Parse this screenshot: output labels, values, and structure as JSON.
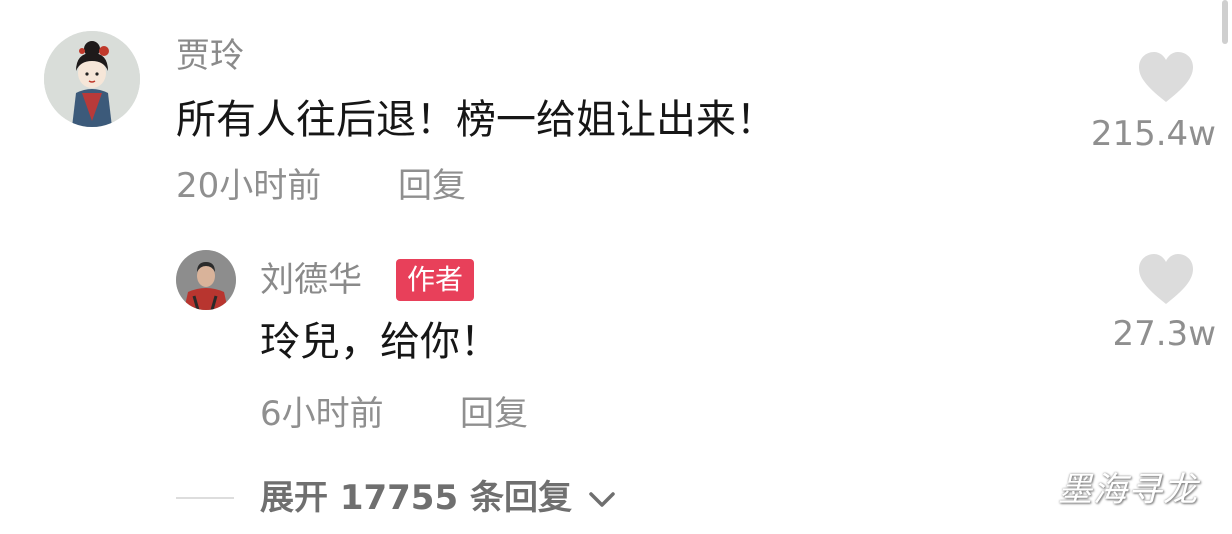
{
  "comment": {
    "username": "贾玲",
    "text": "所有人往后退！榜一给姐让出来！",
    "time": "20小时前",
    "reply_label": "回复",
    "likes": "215.4w",
    "avatar_icon": "avatar-girl-illustration",
    "like_icon": "heart-icon"
  },
  "reply": {
    "username": "刘德华",
    "badge": "作者",
    "text": "玲兒，给你！",
    "time": "6小时前",
    "reply_label": "回复",
    "likes": "27.3w",
    "avatar_icon": "avatar-man-photo",
    "like_icon": "heart-icon"
  },
  "expand": {
    "label": "展开 17755 条回复",
    "icon": "chevron-down-icon"
  },
  "watermark": "墨海寻龙",
  "colors": {
    "badge": "#e8405a",
    "heart": "#dcdcdc",
    "username": "#8a8a8a",
    "text": "#161616"
  }
}
